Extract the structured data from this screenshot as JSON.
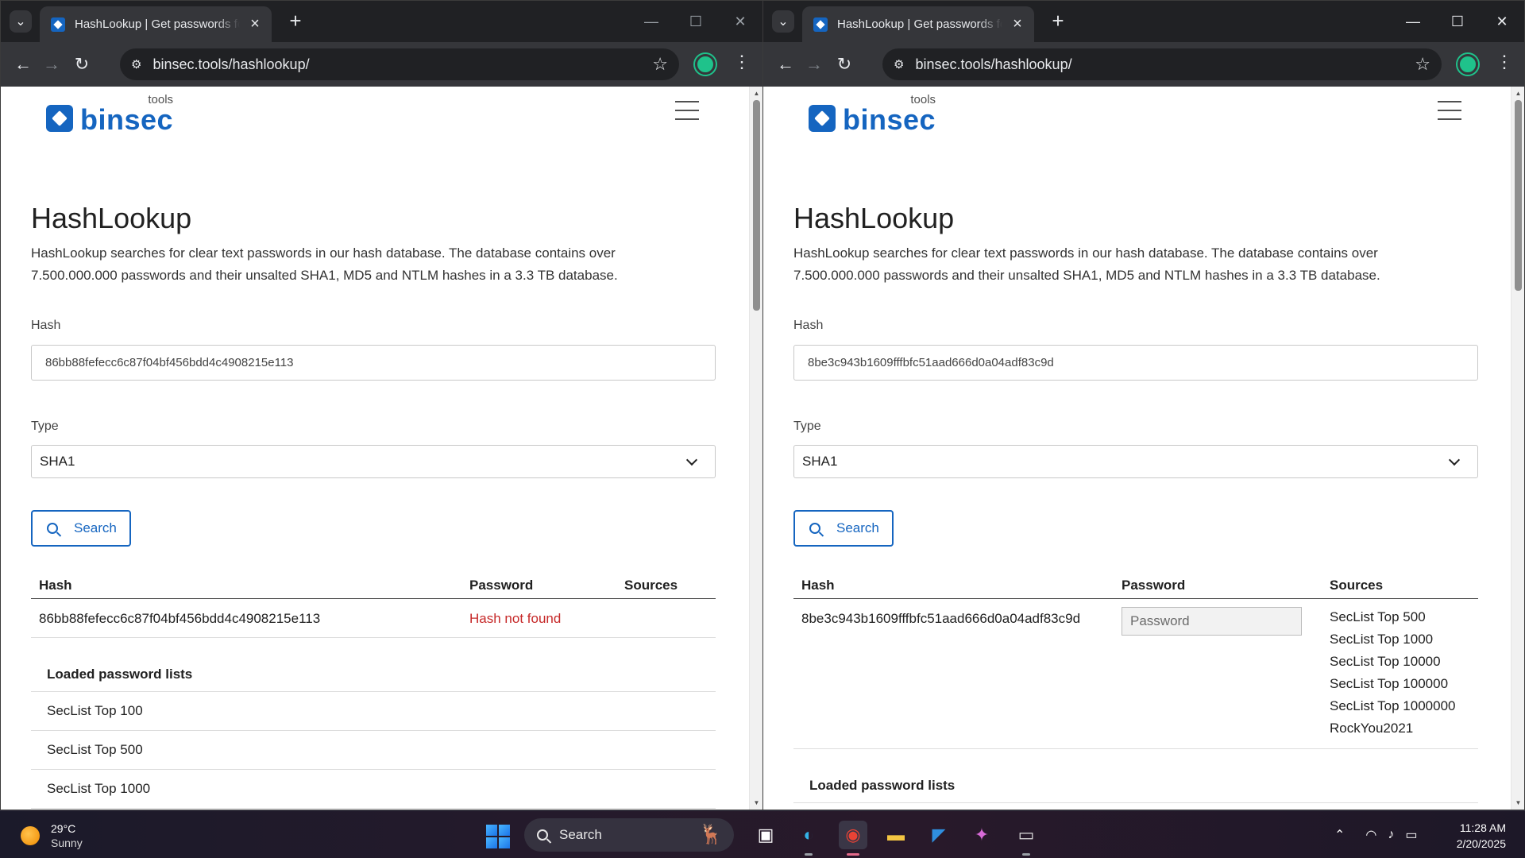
{
  "windows": {
    "left": {
      "tab_title": "HashLookup | Get passwords for",
      "url": "binsec.tools/hashlookup/",
      "hash_value": "86bb88fefecc6c87f04bf456bdd4c4908215e113",
      "type_value": "SHA1",
      "result": {
        "hash": "86bb88fefecc6c87f04bf456bdd4c4908215e113",
        "password": "Hash not found"
      },
      "lists_title": "Loaded password lists",
      "lists": [
        "SecList Top 100",
        "SecList Top 500",
        "SecList Top 1000"
      ]
    },
    "right": {
      "tab_title": "HashLookup | Get passwords for",
      "url": "binsec.tools/hashlookup/",
      "hash_value": "8be3c943b1609fffbfc51aad666d0a04adf83c9d",
      "type_value": "SHA1",
      "result": {
        "hash": "8be3c943b1609fffbfc51aad666d0a04adf83c9d",
        "password_placeholder": "Password",
        "sources": [
          "SecList Top 500",
          "SecList Top 1000",
          "SecList Top 10000",
          "SecList Top 100000",
          "SecList Top 1000000",
          "RockYou2021"
        ]
      },
      "lists_title": "Loaded password lists"
    }
  },
  "page": {
    "logo_text": "binsec",
    "logo_sup": "tools",
    "title": "HashLookup",
    "intro": "HashLookup searches for clear text passwords in our hash database. The database contains over 7.500.000.000 passwords and their unsalted SHA1, MD5 and NTLM hashes in a 3.3 TB database.",
    "hash_label": "Hash",
    "type_label": "Type",
    "search_label": "Search",
    "col_hash": "Hash",
    "col_password": "Password",
    "col_sources": "Sources"
  },
  "taskbar": {
    "weather_temp": "29°C",
    "weather_cond": "Sunny",
    "search_label": "Search",
    "time": "11:28 AM",
    "date": "2/20/2025"
  },
  "colors": {
    "brand": "#1565c0",
    "error": "#c62828",
    "chrome_dark": "#202124",
    "chrome_toolbar": "#35363a"
  }
}
